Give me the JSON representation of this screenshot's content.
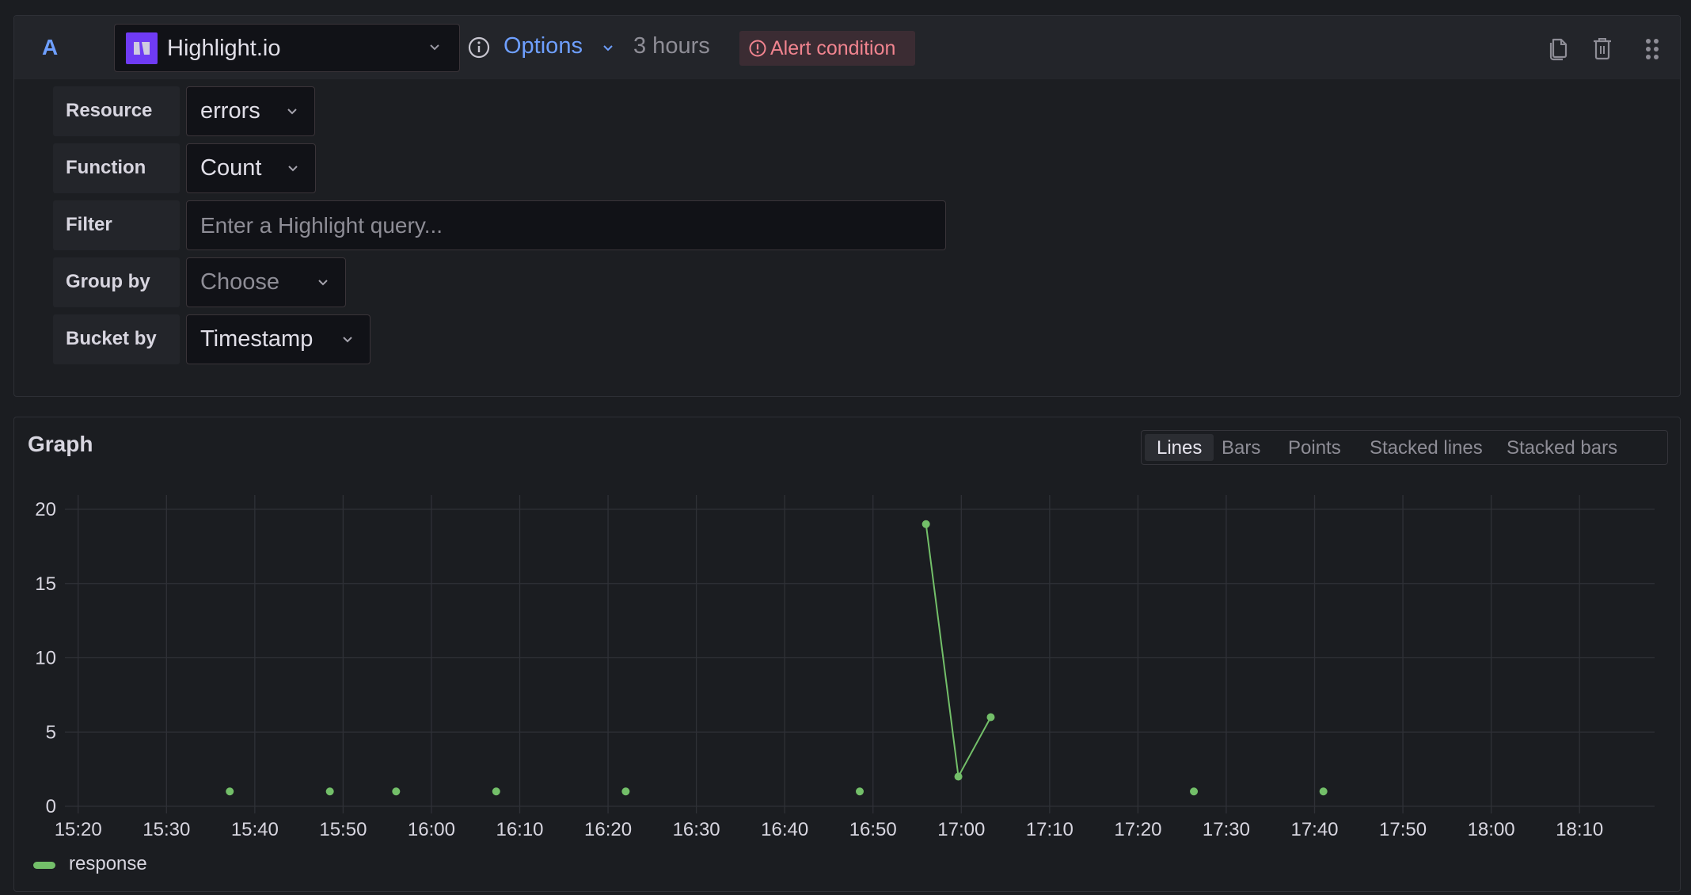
{
  "query": {
    "ref_id": "A",
    "datasource": {
      "name": "Highlight.io",
      "icon": "highlight-logo-icon",
      "brand_color": "#6f3bf5"
    },
    "options_label": "Options",
    "time_range": "3 hours",
    "alert_badge": "Alert condition",
    "header_actions": [
      {
        "name": "duplicate-query",
        "icon": "copy-icon"
      },
      {
        "name": "delete-query",
        "icon": "trash-icon"
      },
      {
        "name": "drag-handle",
        "icon": "grip-icon"
      }
    ],
    "fields": {
      "resource": {
        "label": "Resource",
        "value": "errors"
      },
      "function": {
        "label": "Function",
        "value": "Count"
      },
      "filter": {
        "label": "Filter",
        "value": "",
        "placeholder": "Enter a Highlight query..."
      },
      "group_by": {
        "label": "Group by",
        "value": "",
        "placeholder": "Choose"
      },
      "bucket_by": {
        "label": "Bucket by",
        "value": "Timestamp"
      }
    }
  },
  "graph": {
    "title": "Graph",
    "viz_types": [
      "Lines",
      "Bars",
      "Points",
      "Stacked lines",
      "Stacked bars"
    ],
    "active_viz": "Lines"
  },
  "chart_data": {
    "type": "line",
    "title": "",
    "xlabel": "",
    "ylabel": "",
    "x_ticks": [
      "15:20",
      "15:30",
      "15:40",
      "15:50",
      "16:00",
      "16:10",
      "16:20",
      "16:30",
      "16:40",
      "16:50",
      "17:00",
      "17:10",
      "17:20",
      "17:30",
      "17:40",
      "17:50",
      "18:00",
      "18:10"
    ],
    "y_ticks": [
      0,
      5,
      10,
      15,
      20
    ],
    "ylim": [
      0,
      20
    ],
    "xlim": [
      "15:18:30",
      "18:18:30"
    ],
    "grid": true,
    "legend_position": "bottom-left",
    "series": [
      {
        "name": "response",
        "color": "#73bf69",
        "points": [
          {
            "x": "15:37:10",
            "y": 1
          },
          {
            "x": "15:48:30",
            "y": 1
          },
          {
            "x": "15:56:00",
            "y": 1
          },
          {
            "x": "16:07:20",
            "y": 1
          },
          {
            "x": "16:22:00",
            "y": 1
          },
          {
            "x": "16:48:30",
            "y": 1
          },
          {
            "x": "16:56:00",
            "y": 19
          },
          {
            "x": "16:59:40",
            "y": 2
          },
          {
            "x": "17:03:20",
            "y": 6
          },
          {
            "x": "17:26:20",
            "y": 1
          },
          {
            "x": "17:41:00",
            "y": 1
          }
        ],
        "connected_segments": [
          [
            6,
            7,
            8
          ]
        ]
      }
    ]
  },
  "colors": {
    "accent_blue": "#6e9fff",
    "alert_red": "#f1848f",
    "series_green": "#73bf69"
  }
}
